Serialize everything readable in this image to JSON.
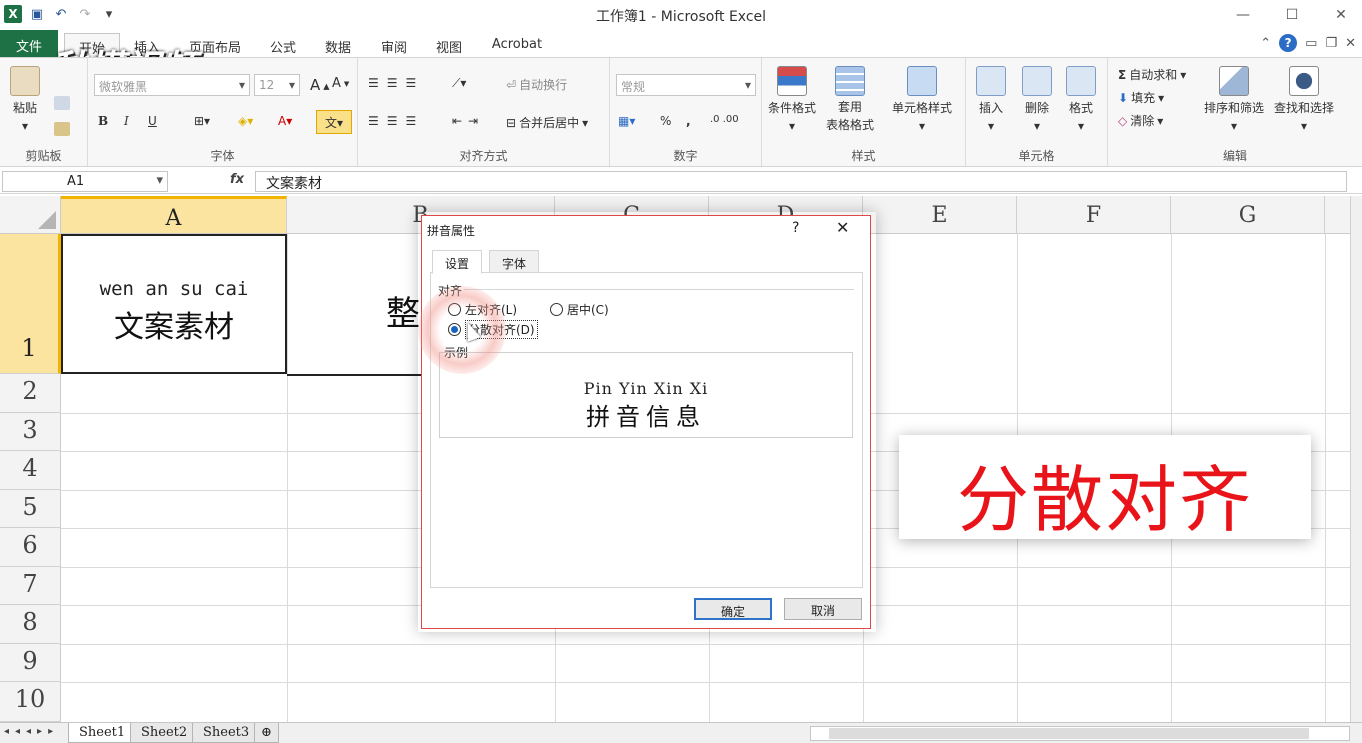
{
  "window": {
    "title": "工作簿1 - Microsoft Excel"
  },
  "ribbon_tabs": [
    "文件",
    "开始",
    "插入",
    "页面布局",
    "公式",
    "数据",
    "审阅",
    "视图",
    "Acrobat"
  ],
  "watermark": "秒懂视频",
  "ribbon": {
    "clipboard": {
      "paste": "粘贴",
      "label": "剪贴板"
    },
    "font": {
      "name": "微软雅黑",
      "size": "12",
      "label": "字体",
      "bold": "B",
      "italic": "I",
      "underline": "U"
    },
    "alignment": {
      "wrap": "自动换行",
      "merge": "合并后居中",
      "label": "对齐方式"
    },
    "number": {
      "format": "常规",
      "percent": "%",
      "comma": ",",
      "label": "数字"
    },
    "styles": {
      "conditional": "条件格式",
      "table": "套用\n表格格式",
      "table_line1": "套用",
      "table_line2": "表格格式",
      "cell_styles": "单元格样式",
      "label": "样式"
    },
    "cells": {
      "insert": "插入",
      "delete": "删除",
      "format": "格式",
      "label": "单元格"
    },
    "editing": {
      "autosum": "自动求和",
      "fill": "填充",
      "clear": "清除",
      "sort": "排序和筛选",
      "find": "查找和选择",
      "label": "编辑"
    }
  },
  "formula_bar": {
    "name_box": "A1",
    "fx": "fx",
    "value": "文案素材"
  },
  "columns": [
    "A",
    "B",
    "C",
    "D",
    "E",
    "F",
    "G"
  ],
  "rows": [
    "1",
    "2",
    "3",
    "4",
    "5",
    "6",
    "7",
    "8",
    "9",
    "10"
  ],
  "cells": {
    "A1_pinyin": "wen an su cai",
    "A1_text": "文案素材",
    "B1_text": "整"
  },
  "dialog": {
    "title": "拼音属性",
    "help": "?",
    "close": "✕",
    "tabs": [
      "设置",
      "字体"
    ],
    "alignment_label": "对齐",
    "options": {
      "left": "左对齐(L)",
      "center": "居中(C)",
      "distributed": "分散对齐(D)"
    },
    "selected": "distributed",
    "preview_label": "示例",
    "preview_pinyin": "Pin Yin Xin Xi",
    "preview_text": "拼音信息",
    "ok": "确定",
    "cancel": "取消"
  },
  "sheets": [
    "Sheet1",
    "Sheet2",
    "Sheet3"
  ],
  "caption": "分散对齐"
}
